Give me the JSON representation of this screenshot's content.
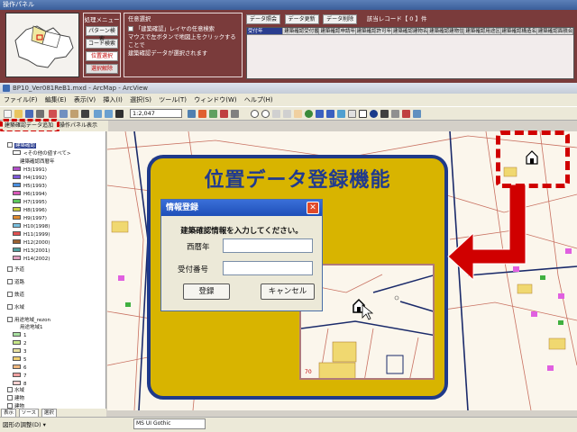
{
  "op_panel": {
    "title": "操作パネル",
    "menu_header": "処理メニュー",
    "menu_items": [
      "パターン検索",
      "コード検索",
      "位置選択",
      "選択解除"
    ],
    "select_header": "任意選択",
    "select_option": "「建築確認」レイヤの任意検索",
    "select_note_line1": "マウスで左ボタンで地図上をクリックすることで",
    "select_note_line2": "建築確認データが選択されます",
    "toolbar_buttons": [
      "データ照会",
      "データ更新",
      "データ削除"
    ],
    "record_count": "該当レコード【 0 】件",
    "grid_columns": [
      "受付年",
      "建築確認受付番号",
      "建築確認申請年月日",
      "建築確認許可年月日",
      "建築確認建物名称",
      "建築確認建物住所",
      "建築確認用途区分",
      "建築確認構造名称",
      "建築確認面積合計"
    ]
  },
  "arcview": {
    "title": "BP10_Ver081ReB1.mxd - ArcMap - ArcView",
    "menu": [
      "ファイル(F)",
      "編集(E)",
      "表示(V)",
      "挿入(I)",
      "選択(S)",
      "ツール(T)",
      "ウィンドウ(W)",
      "ヘルプ(H)"
    ],
    "scale": "1:2,047",
    "tab_add": "建築確認データ追加",
    "tab_panel": "操作パネル表示",
    "font_name": "MS UI Gothic",
    "draw_label": "図形の調整(D) ▾"
  },
  "toc": {
    "layers": [
      {
        "label": "建築確認",
        "selected": true,
        "checked": true,
        "swatch": ""
      },
      {
        "label": "<その他の値すべて>",
        "swatch": ""
      },
      {
        "label": "建築確認西暦年",
        "swatch": ""
      },
      {
        "label": "H3(1991)",
        "swatch": "#b04ec8"
      },
      {
        "label": "H4(1992)",
        "swatch": "#7d5ad8"
      },
      {
        "label": "H5(1993)",
        "swatch": "#4a8fe0"
      },
      {
        "label": "H6(1994)",
        "swatch": "#d858b8"
      },
      {
        "label": "H7(1995)",
        "swatch": "#5cc85c"
      },
      {
        "label": "H8(1996)",
        "swatch": "#c8d040"
      },
      {
        "label": "H9(1997)",
        "swatch": "#e08a30"
      },
      {
        "label": "H10(1998)",
        "swatch": "#7ac0e0"
      },
      {
        "label": "H11(1999)",
        "swatch": "#e05050"
      },
      {
        "label": "H12(2000)",
        "swatch": "#9a6030"
      },
      {
        "label": "H13(2001)",
        "swatch": "#50a0a0"
      },
      {
        "label": "H14(2002)",
        "swatch": "#e0a0c0"
      }
    ],
    "groups": [
      {
        "label": "予道",
        "checked": true
      },
      {
        "label": "道路",
        "checked": true
      },
      {
        "label": "鉄道",
        "checked": true
      },
      {
        "label": "水域",
        "checked": false
      },
      {
        "label": "用途地域_rezon",
        "checked": true
      },
      {
        "label": "用途地域1",
        "checked": false
      }
    ],
    "zone_items": [
      {
        "label": "1",
        "swatch": "#a8e0a0"
      },
      {
        "label": "2",
        "swatch": "#c8e888"
      },
      {
        "label": "3",
        "swatch": "#e8e0a0"
      },
      {
        "label": "5",
        "swatch": "#f0d070"
      },
      {
        "label": "6",
        "swatch": "#f0b880"
      },
      {
        "label": "7",
        "swatch": "#f0a0a0"
      },
      {
        "label": "8",
        "swatch": "#f8d0d0"
      }
    ],
    "bottom_groups": [
      {
        "label": "水域",
        "checked": true
      },
      {
        "label": "建物",
        "checked": true
      },
      {
        "label": "建物",
        "checked": true
      }
    ],
    "tabs": [
      "表示",
      "ソース",
      "選択"
    ]
  },
  "feature": {
    "title": "位置データ登録機能"
  },
  "dialog": {
    "title": "情報登録",
    "message": "建築確認情報を入力してください。",
    "field1_label": "西暦年",
    "field1_value": "",
    "field2_label": "受付番号",
    "field2_value": "",
    "ok_label": "登録",
    "cancel_label": "キャンセル"
  },
  "colors": {
    "panel_bg": "#7a3b3b",
    "feature_bg": "#d8b400",
    "feature_border": "#1f3a8a",
    "highlight_red": "#d00000"
  }
}
